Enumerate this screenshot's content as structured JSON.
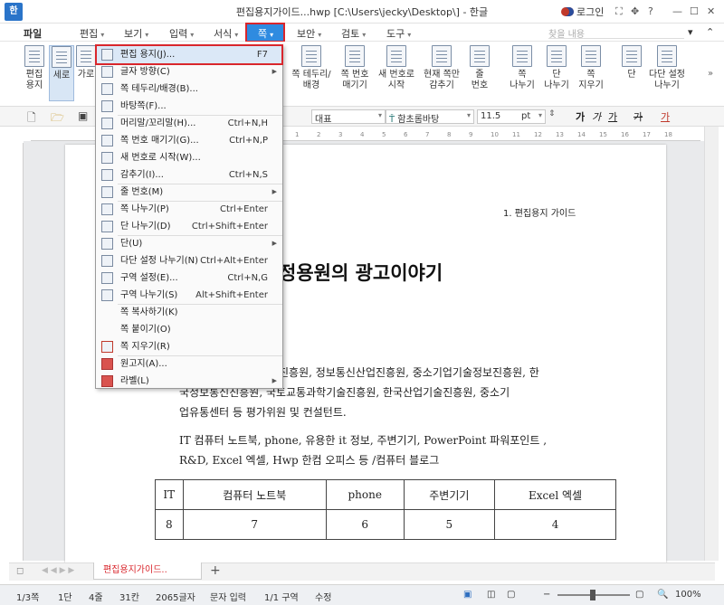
{
  "window": {
    "title": "편집용지가이드...hwp [C:\\Users\\jecky\\Desktop\\] - 한글",
    "app_icon": "한",
    "login": "로그인"
  },
  "menubar": {
    "file": "파일",
    "edit": "편집",
    "view": "보기",
    "input": "입력",
    "format": "서식",
    "page": "쪽",
    "security": "보안",
    "review": "검토",
    "tools": "도구",
    "search_placeholder": "찾을 내용"
  },
  "ribbon": {
    "edit_paper": "편집\n용지",
    "portrait": "세로",
    "landscape": "가로",
    "page_border": "쪽 테두리/\n배경",
    "page_number": "쪽 번호\n매기기",
    "new_number": "새 번호로\n시작",
    "hide_current": "현재 쪽만\n감추기",
    "line_number": "줄\n번호",
    "page_break": "쪽\n나누기",
    "col_break": "단\n나누기",
    "delete_page": "쪽\n지우기",
    "columns": "단",
    "multi_col": "다단 설정\n나누기"
  },
  "fmtbar": {
    "style": "대표",
    "font": "함초롬바탕",
    "size": "11.5",
    "unit": "pt",
    "bold_label": "가",
    "italic_label": "가",
    "underline_label": "가",
    "strike_label": "가",
    "color_label": "가"
  },
  "ruler": {
    "ticks": [
      "1",
      "2",
      "3",
      "4",
      "5",
      "6",
      "7",
      "8",
      "9",
      "10",
      "11",
      "12",
      "13",
      "14",
      "15",
      "16",
      "17",
      "18"
    ]
  },
  "dropdown": {
    "items": [
      {
        "label": "편집 용지(J)...",
        "shortcut": "F7",
        "sub": false
      },
      {
        "label": "글자 방향(C)",
        "shortcut": "",
        "sub": true
      },
      {
        "label": "쪽 테두리/배경(B)...",
        "shortcut": "",
        "sub": false
      },
      {
        "label": "바탕쪽(F)...",
        "shortcut": "",
        "sub": false
      },
      {
        "label": "머리말/꼬리말(H)...",
        "shortcut": "Ctrl+N,H",
        "sub": false
      },
      {
        "label": "쪽 번호 매기기(G)...",
        "shortcut": "Ctrl+N,P",
        "sub": false
      },
      {
        "label": "새 번호로 시작(W)...",
        "shortcut": "",
        "sub": false
      },
      {
        "label": "감추기(I)...",
        "shortcut": "Ctrl+N,S",
        "sub": false
      },
      {
        "label": "줄 번호(M)",
        "shortcut": "",
        "sub": true
      },
      {
        "label": "쪽 나누기(P)",
        "shortcut": "Ctrl+Enter",
        "sub": false
      },
      {
        "label": "단 나누기(D)",
        "shortcut": "Ctrl+Shift+Enter",
        "sub": false
      },
      {
        "label": "단(U)",
        "shortcut": "",
        "sub": true
      },
      {
        "label": "다단 설정 나누기(N)",
        "shortcut": "Ctrl+Alt+Enter",
        "sub": false
      },
      {
        "label": "구역 설정(E)...",
        "shortcut": "Ctrl+N,G",
        "sub": false
      },
      {
        "label": "구역 나누기(S)",
        "shortcut": "Alt+Shift+Enter",
        "sub": false
      },
      {
        "label": "쪽 복사하기(K)",
        "shortcut": "",
        "sub": false
      },
      {
        "label": "쪽 붙이기(O)",
        "shortcut": "",
        "sub": false
      },
      {
        "label": "쪽 지우기(R)",
        "shortcut": "",
        "sub": false
      },
      {
        "label": "원고지(A)...",
        "shortcut": "",
        "sub": false
      },
      {
        "label": "라벨(L)",
        "shortcut": "",
        "sub": true
      }
    ]
  },
  "document": {
    "header": "1. 편집용지 가이드",
    "title": "정용원의 광고이야기",
    "para1_line1": "진흥원, 정보통신산업진흥원, 중소기업기술정보진흥원, 한",
    "para1_line2": "국정보통신진흥원, 국토교통과학기술진흥원, 한국산업기술진흥원, 중소기",
    "para1_line3": "업유통센터 등 평가위원 및 컨설턴트.",
    "para2_line1": "IT 컴퓨터 노트북, phone, 유용한 it 정보, 주변기기, PowerPoint 파워포인트 ,",
    "para2_line2": "R&D, Excel 엑셀, Hwp 한컴 오피스 등 /컴퓨터 블로그",
    "table": {
      "headers": [
        "IT",
        "컴퓨터 노트북",
        "phone",
        "주변기기",
        "Excel 엑셀"
      ],
      "values": [
        "8",
        "7",
        "6",
        "5",
        "4"
      ]
    }
  },
  "tabs": {
    "doc_tab": "편집용지가이드..",
    "add": "+"
  },
  "status": {
    "page": "1/3쪽",
    "col": "1단",
    "line": "4줄",
    "char": "31칸",
    "count": "2065글자",
    "mode": "문자 입력",
    "section": "1/1 구역",
    "edit": "수정",
    "zoom": "100%"
  }
}
